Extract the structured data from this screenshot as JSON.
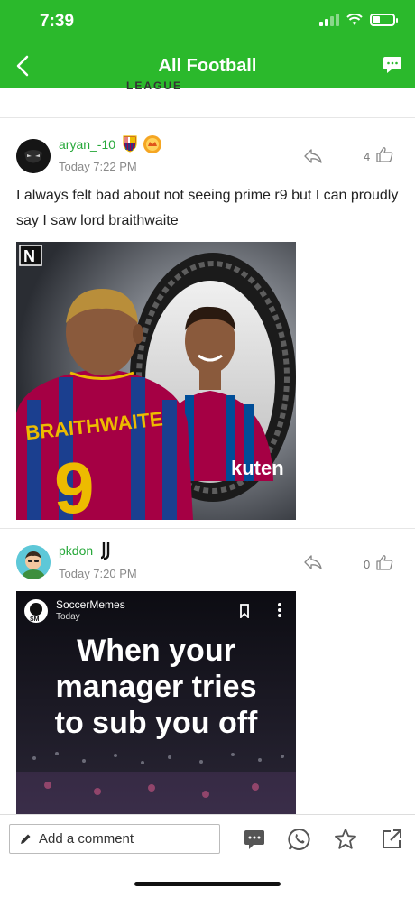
{
  "status_bar": {
    "time": "7:39"
  },
  "header": {
    "title": "All Football"
  },
  "top_fragment": {
    "text": "LEAGUE"
  },
  "posts": [
    {
      "username": "aryan_-10",
      "time": "Today 7:22 PM",
      "likes": "4",
      "text": "I always felt bad about not seeing prime r9 but I can proudly say I saw lord braithwaite",
      "image_texts": {
        "watermark": "N",
        "shirt_name": "BRAITHWAITE",
        "shirt_number": "9",
        "sponsor": "kuten"
      }
    },
    {
      "username": "pkdon",
      "time": "Today 7:20 PM",
      "likes": "0",
      "image_texts": {
        "account": "SoccerMemes",
        "account_time": "Today",
        "caption_lines": [
          "When your",
          "manager tries",
          "to sub you off"
        ]
      }
    }
  ],
  "bottom_bar": {
    "comment_placeholder": "Add a comment"
  },
  "colors": {
    "brand_green": "#2bb92c",
    "username_green": "#27a83a"
  }
}
